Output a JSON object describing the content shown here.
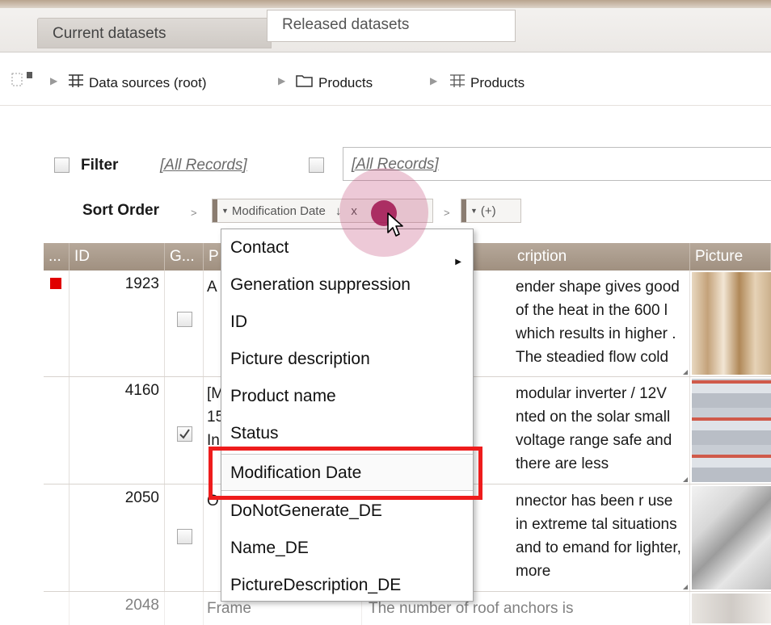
{
  "tabs": [
    {
      "label": "Current datasets",
      "active": true
    },
    {
      "label": "Released datasets",
      "active": false
    }
  ],
  "breadcrumb": [
    {
      "label": "Data sources (root)",
      "icon": "table-icon"
    },
    {
      "label": "Products",
      "icon": "folder-icon"
    },
    {
      "label": "Products",
      "icon": "table-icon"
    }
  ],
  "filter": {
    "label": "Filter",
    "link_text": "[All Records]",
    "input_value": "[All Records]"
  },
  "sort": {
    "label": "Sort Order",
    "chip_field": "Modification Date",
    "chip_direction": "↓",
    "chip_remove": "x",
    "add_label": "(+)"
  },
  "columns": [
    "...",
    "ID",
    "G...",
    "P",
    "cription",
    "Picture"
  ],
  "rows": [
    {
      "id": "1923",
      "status_color": "#e00000",
      "generate_checked": false,
      "product": "A",
      "description": "ender shape gives good of the heat in the 600 l which results in higher . The steadied flow cold"
    },
    {
      "id": "4160",
      "status_color": "",
      "generate_checked": true,
      "product": "[M\n15\nIn",
      "description": "modular inverter / 12V nted on the solar small voltage range safe and there are less"
    },
    {
      "id": "2050",
      "status_color": "",
      "generate_checked": false,
      "product": "O",
      "description": "nnector has been r use in extreme tal situations and to emand for lighter, more"
    },
    {
      "id": "2048",
      "status_color": "",
      "generate_checked": false,
      "product": "Frame",
      "description": "The number of roof anchors is"
    }
  ],
  "dropdown": {
    "items": [
      {
        "label": "Contact",
        "has_submenu": true
      },
      {
        "label": "Generation suppression",
        "has_submenu": false
      },
      {
        "label": "ID",
        "has_submenu": false
      },
      {
        "label": "Picture description",
        "has_submenu": false
      },
      {
        "label": "Product name",
        "has_submenu": false
      },
      {
        "label": "Status",
        "has_submenu": false
      },
      {
        "label": "Modification Date",
        "has_submenu": false,
        "highlighted": true
      },
      {
        "label": "DoNotGenerate_DE",
        "has_submenu": false
      },
      {
        "label": "Name_DE",
        "has_submenu": false
      },
      {
        "label": "PictureDescription_DE",
        "has_submenu": false
      }
    ]
  },
  "colors": {
    "header_bg": "#a89888",
    "annotation_red": "#ee1c1c",
    "status_red": "#e00000",
    "click_highlight": "#a01450"
  }
}
